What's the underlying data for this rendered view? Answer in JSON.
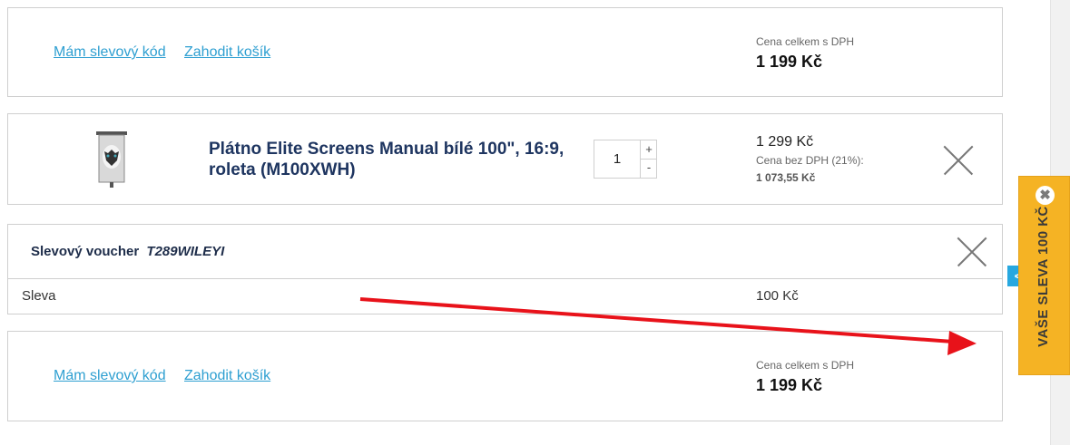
{
  "cart_top": {
    "coupon_link": "Mám slevový kód",
    "discard_link": "Zahodit košík",
    "total_label": "Cena celkem s DPH",
    "total_value": "1 199 Kč"
  },
  "product": {
    "title": "Plátno Elite Screens Manual bílé 100\", 16:9, roleta (M100XWH)",
    "quantity": "1",
    "plus": "+",
    "minus": "-",
    "price": "1 299 Kč",
    "vat_label": "Cena bez DPH (21%):",
    "vat_value": "1 073,55 Kč"
  },
  "voucher": {
    "label": "Slevový voucher",
    "code": "T289WILEYI",
    "discount_label": "Sleva",
    "discount_value": "100 Kč"
  },
  "cart_bottom": {
    "coupon_link": "Mám slevový kód",
    "discard_link": "Zahodit košík",
    "total_label": "Cena celkem s DPH",
    "total_value": "1 199 Kč"
  },
  "side_tab": {
    "text": "VAŠE SLEVA 100 KČ",
    "close": "✖",
    "toggle": "<"
  },
  "colors": {
    "link": "#2e9fd1",
    "title": "#1e3560",
    "tab": "#f5b324",
    "toggle": "#27a8e0",
    "arrow": "#e8121a"
  },
  "icons": [
    "close-icon",
    "product-thumbnail",
    "annotation-arrow"
  ]
}
